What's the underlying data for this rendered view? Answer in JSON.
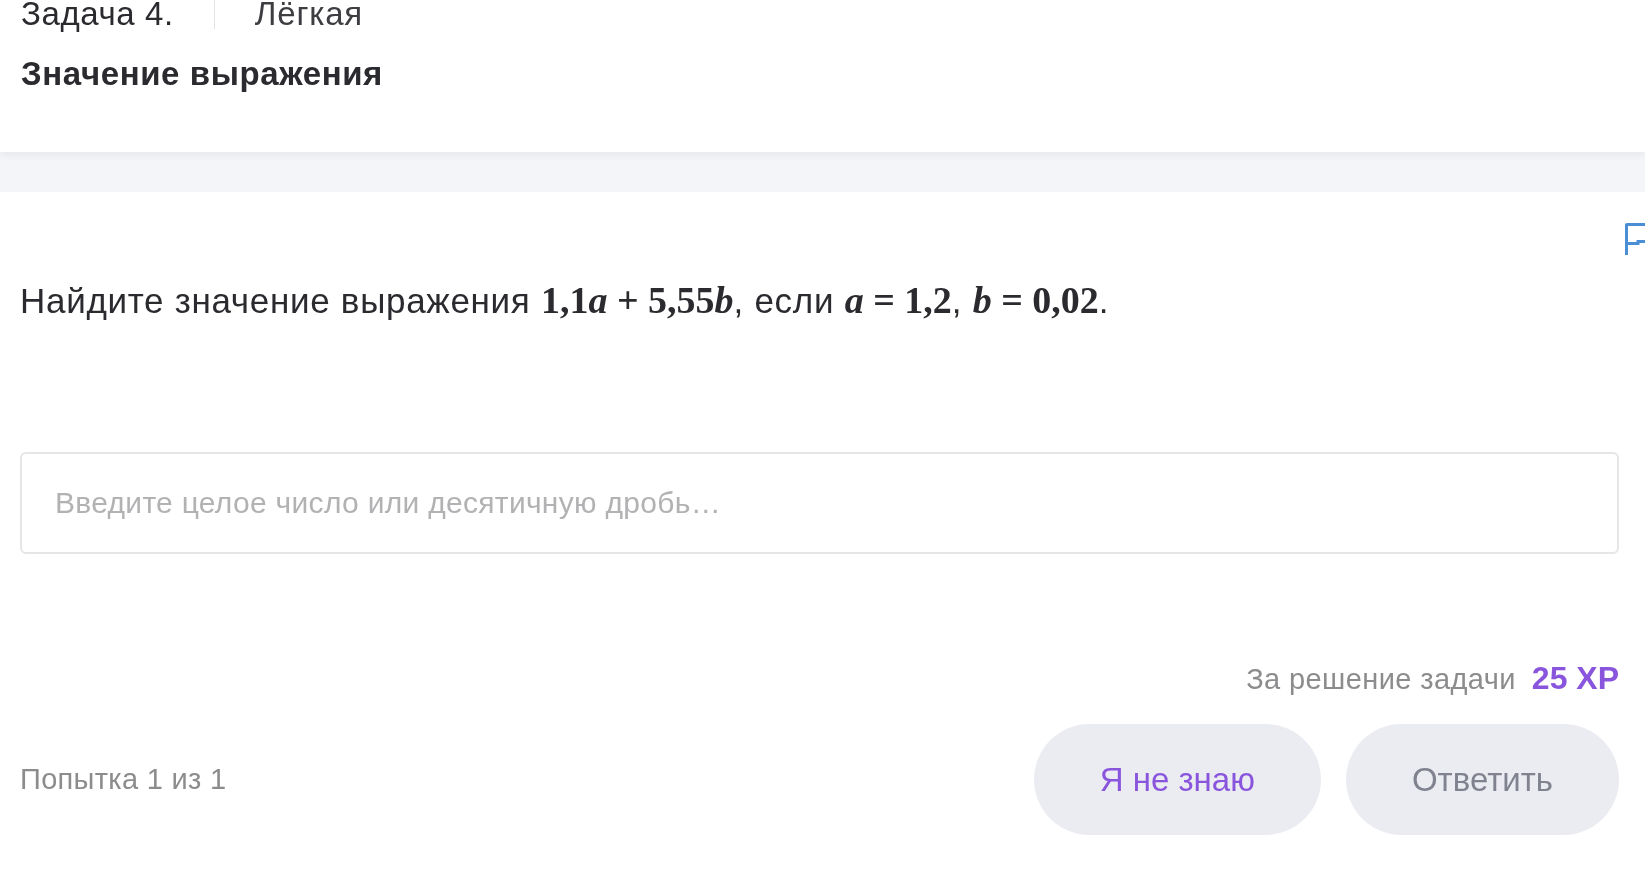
{
  "header": {
    "task_number": "Задача 4.",
    "difficulty": "Лёгкая",
    "title": "Значение выражения"
  },
  "question": {
    "parts": [
      {
        "kind": "text",
        "text": "Найдите значение выражения "
      },
      {
        "kind": "num",
        "text": "1,1"
      },
      {
        "kind": "var",
        "text": "a"
      },
      {
        "kind": "num",
        "text": " + 5,55"
      },
      {
        "kind": "var",
        "text": "b"
      },
      {
        "kind": "text",
        "text": ", если "
      },
      {
        "kind": "var",
        "text": "a"
      },
      {
        "kind": "num",
        "text": " = 1,2"
      },
      {
        "kind": "text",
        "text": ", "
      },
      {
        "kind": "var",
        "text": "b"
      },
      {
        "kind": "num",
        "text": " = 0,02"
      },
      {
        "kind": "text",
        "text": "."
      }
    ]
  },
  "answer": {
    "placeholder": "Введите целое число или десятичную дробь…"
  },
  "reward": {
    "label": "За решение задачи",
    "points": "25 XP"
  },
  "attempts": "Попытка 1 из 1",
  "buttons": [
    {
      "label": "Я не знаю",
      "disabled": false
    },
    {
      "label": "Ответить",
      "disabled": true
    }
  ]
}
